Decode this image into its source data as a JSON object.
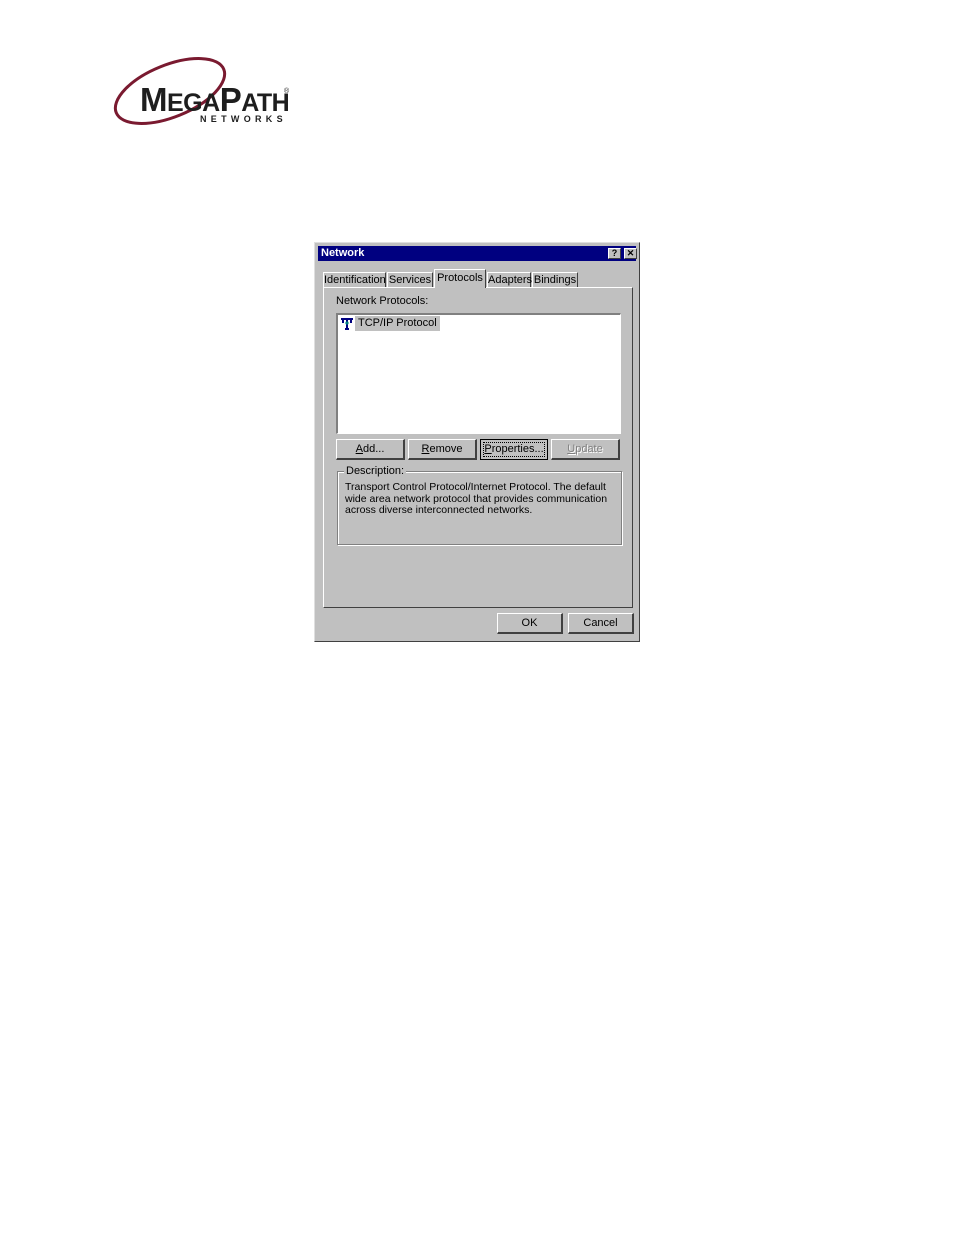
{
  "logo": {
    "brand_first": "M",
    "brand_rest_1": "EGA",
    "brand_mid": "P",
    "brand_rest_2": "ATH",
    "registered": "®",
    "subtitle": "NETWORKS",
    "color_swoosh": "#7a1a30"
  },
  "dialog": {
    "title": "Network",
    "help_glyph": "?",
    "close_glyph": "✕",
    "tabs": [
      {
        "label": "Identification",
        "active": false
      },
      {
        "label": "Services",
        "active": false
      },
      {
        "label": "Protocols",
        "active": true
      },
      {
        "label": "Adapters",
        "active": false
      },
      {
        "label": "Bindings",
        "active": false
      }
    ],
    "protocols_label": "Network Protocols:",
    "protocols": [
      {
        "icon": "network-protocol-icon",
        "label": "TCP/IP Protocol",
        "selected": true
      }
    ],
    "buttons": {
      "add_mnemonic": "A",
      "add_rest": "dd...",
      "remove_mnemonic": "R",
      "remove_rest": "emove",
      "properties_mnemonic": "P",
      "properties_rest": "roperties...",
      "update_mnemonic": "U",
      "update_rest": "pdate"
    },
    "description_title": "Description:",
    "description_text": "Transport Control Protocol/Internet Protocol. The default wide area network protocol that provides communication across diverse interconnected networks.",
    "ok_label": "OK",
    "cancel_label": "Cancel",
    "colors": {
      "titlebar": "#000080",
      "face": "#c0c0c0"
    }
  }
}
